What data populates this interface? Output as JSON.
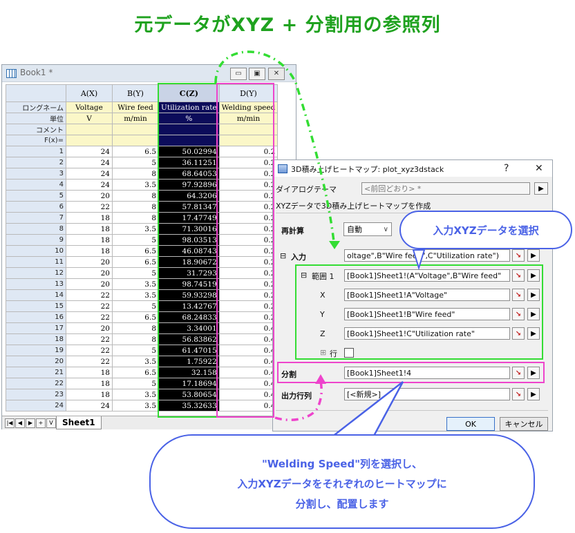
{
  "heading": "元データがXYZ + 分割用の参照列",
  "workbook": {
    "title": "Book1 *",
    "btn_min": "▭",
    "btn_restore": "▣",
    "btn_close": "✕",
    "columns": [
      "A(X)",
      "B(Y)",
      "C(Z)",
      "D(Y)"
    ],
    "meta_labels": [
      "ロングネーム",
      "単位",
      "コメント",
      "F(x)="
    ],
    "longnames": [
      "Voltage",
      "Wire feed",
      "Utilization rate",
      "Welding speed"
    ],
    "units": [
      "V",
      "m/min",
      "%",
      "m/min"
    ],
    "rows": [
      [
        "1",
        "24",
        "6.5",
        "50.02994",
        "0.2"
      ],
      [
        "2",
        "24",
        "5",
        "36.11251",
        "0.2"
      ],
      [
        "3",
        "24",
        "8",
        "68.64053",
        "0.2"
      ],
      [
        "4",
        "24",
        "3.5",
        "97.92896",
        "0.2"
      ],
      [
        "5",
        "20",
        "8",
        "64.3206",
        "0.2"
      ],
      [
        "6",
        "22",
        "8",
        "57.81347",
        "0.2"
      ],
      [
        "7",
        "18",
        "8",
        "17.47749",
        "0.2"
      ],
      [
        "8",
        "18",
        "3.5",
        "71.30016",
        "0.2"
      ],
      [
        "9",
        "18",
        "5",
        "98.03513",
        "0.2"
      ],
      [
        "10",
        "18",
        "6.5",
        "46.08743",
        "0.2"
      ],
      [
        "11",
        "20",
        "6.5",
        "18.90672",
        "0.2"
      ],
      [
        "12",
        "20",
        "5",
        "31.7293",
        "0.2"
      ],
      [
        "13",
        "20",
        "3.5",
        "98.74519",
        "0.2"
      ],
      [
        "14",
        "22",
        "3.5",
        "59.93298",
        "0.2"
      ],
      [
        "15",
        "22",
        "5",
        "13.42767",
        "0.2"
      ],
      [
        "16",
        "22",
        "6.5",
        "68.24833",
        "0.2"
      ],
      [
        "17",
        "20",
        "8",
        "3.34001",
        "0.4"
      ],
      [
        "18",
        "22",
        "8",
        "56.83862",
        "0.4"
      ],
      [
        "19",
        "22",
        "5",
        "61.47015",
        "0.4"
      ],
      [
        "20",
        "22",
        "3.5",
        "1.75922",
        "0.4"
      ],
      [
        "21",
        "18",
        "6.5",
        "32.158",
        "0.4"
      ],
      [
        "22",
        "18",
        "5",
        "17.18694",
        "0.4"
      ],
      [
        "23",
        "18",
        "3.5",
        "53.80654",
        "0.4"
      ],
      [
        "24",
        "24",
        "3.5",
        "35.32633",
        "0.4"
      ]
    ],
    "sheet_tab": "Sheet1",
    "nav_buttons": [
      "|◀",
      "◀",
      "▶",
      "+",
      "V"
    ]
  },
  "dialog": {
    "title": "3D積み上げヒートマップ: plot_xyz3dstack",
    "help_btn": "?",
    "close_btn": "✕",
    "theme_label": "ダイアログテーマ",
    "theme_value": "<前回どおり> *",
    "theme_btn": "▶",
    "description": "XYZデータで3D積み上げヒートマップを作成",
    "recalc_label": "再計算",
    "recalc_value": "自動",
    "input_label": "入力",
    "input_value": "oltage\",B\"Wire feed\",C\"Utilization rate\")",
    "range_label": "範囲 1",
    "range_value": "[Book1]Sheet1!(A\"Voltage\",B\"Wire feed\"",
    "x_label": "X",
    "x_value": "[Book1]Sheet1!A\"Voltage\"",
    "y_label": "Y",
    "y_value": "[Book1]Sheet1!B\"Wire feed\"",
    "z_label": "Z",
    "z_value": "[Book1]Sheet1!C\"Utilization rate\"",
    "row_label": "行",
    "split_label": "分割",
    "split_value": "[Book1]Sheet1!4",
    "output_label": "出力行列",
    "output_value": "[<新規>]",
    "ok": "OK",
    "cancel": "キャンセル",
    "collapse": "⊟",
    "expand": "⊞",
    "pick_icon": "↘",
    "arrow_icon": "▶"
  },
  "callout_top": "入力XYZデータを選択",
  "callout_bottom": [
    "\"Welding Speed\"列を選択し、",
    "入力XYZデータをそれぞれのヒートマップに",
    "分割し、配置します"
  ],
  "colors": {
    "green": "#33dd33",
    "pink": "#ee44cc",
    "blue": "#4a62e6",
    "heading": "#1fa21f"
  }
}
